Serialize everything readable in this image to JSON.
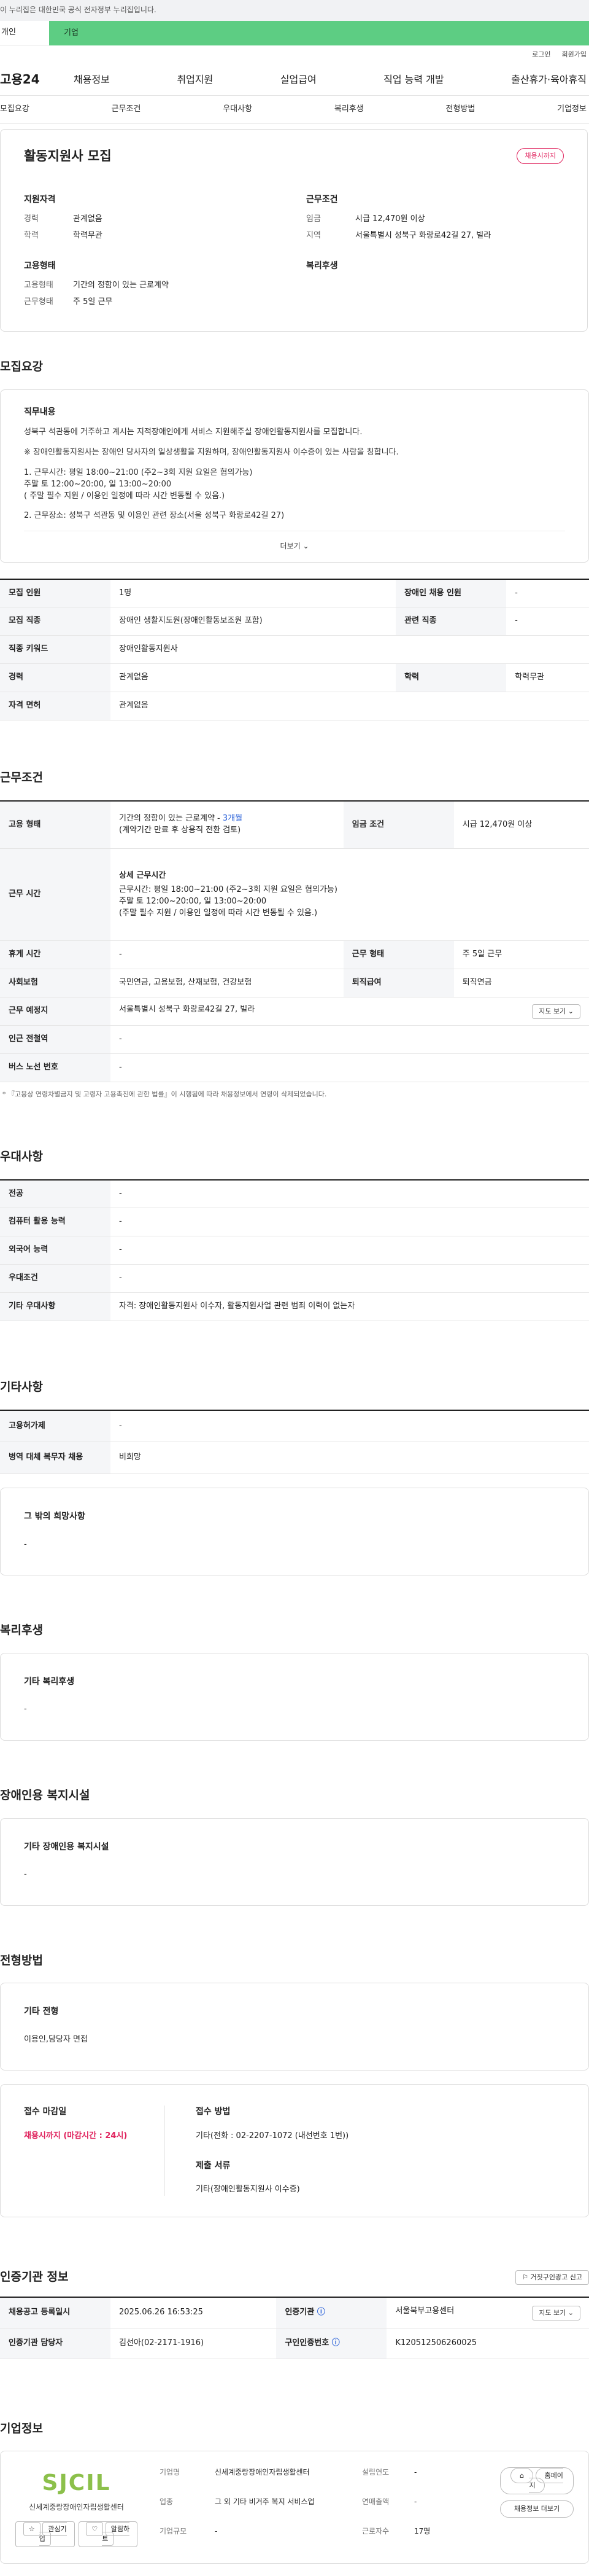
{
  "top_banner": "이 누리집은 대한민국 공식 전자정부 누리집입니다.",
  "tabs": {
    "personal": "개인",
    "business": "기업"
  },
  "util": {
    "login": "로그인",
    "join": "회원가입"
  },
  "gnb": {
    "logo": "고용24",
    "menu": [
      "채용정보",
      "취업지원",
      "실업급여",
      "직업 능력 개발",
      "출산휴가·육아휴직"
    ]
  },
  "subnav": [
    "모집요강",
    "근무조건",
    "우대사항",
    "복리후생",
    "전형방법",
    "기업정보"
  ],
  "header": {
    "title": "활동지원사 모집",
    "badge": "채용시까지",
    "qualification": {
      "heading": "지원자격",
      "rows": [
        {
          "k": "경력",
          "v": "관계없음"
        },
        {
          "k": "학력",
          "v": "학력무관"
        }
      ]
    },
    "work_condition": {
      "heading": "근무조건",
      "rows": [
        {
          "k": "임금",
          "v": "시급 12,470원 이상"
        },
        {
          "k": "지역",
          "v": "서울특별시 성북구 화랑로42길 27, 빌라"
        }
      ]
    },
    "employment": {
      "heading": "고용형태",
      "rows": [
        {
          "k": "고용형태",
          "v": "기간의 정함이 있는 근로계약"
        },
        {
          "k": "근무형태",
          "v": "주 5일 근무"
        }
      ]
    },
    "welfare": {
      "heading": "복리후생"
    }
  },
  "recruit": {
    "title": "모집요강",
    "duty_heading": "직무내용",
    "duty_p1": "성북구 석관동에 거주하고 계시는 지적장애인에게 서비스 지원해주실 장애인활동지원사를 모집합니다.",
    "duty_p2": "※ 장애인활동지원사는 장애인 당사자의 일상생활을 지원하며, 장애인활동지원사 이수증이 있는 사람을 칭합니다.",
    "duty_p3": "1. 근무시간: 평일  18:00~21:00 (주2~3회 지원 요일은 협의가능)\n주말  토 12:00~20:00, 일 13:00~20:00\n( 주말 필수 지원 / 이용인 일정에 따라 시간 변동될 수 있음.)",
    "duty_p4": "2. 근무장소: 성북구 석관동 및 이용인 관련 장소(서울 성북구 화랑로42길 27)",
    "more": "더보기",
    "table": {
      "headcount_label": "모집 인원",
      "headcount": "1명",
      "disabled_label": "장애인 채용 인원",
      "disabled": "-",
      "job_label": "모집 직종",
      "job": "장애인 생활지도원(장애인활동보조원 포함)",
      "related_label": "관련 직종",
      "related": "-",
      "keyword_label": "직종 키워드",
      "keyword": "장애인활동지원사",
      "career_label": "경력",
      "career": "관계없음",
      "edu_label": "학력",
      "edu": "학력무관",
      "license_label": "자격 면허",
      "license": "관계없음"
    }
  },
  "work": {
    "title": "근무조건",
    "emp_type_label": "고용 형태",
    "emp_type_1": "기간의 정함이 있는 근로계약 - ",
    "emp_type_months": "3개월",
    "emp_type_2": "(계약기간 만료 후 상용직 전환 검토)",
    "wage_label": "임금 조건",
    "wage": "시급 12,470원 이상",
    "hours_label": "근무 시간",
    "hours_heading": "상세 근무시간",
    "hours_text": "근무시간: 평일  18:00~21:00 (주2~3회 지원 요일은 협의가능)\n주말  토 12:00~20:00, 일 13:00~20:00\n(주말 필수 지원 / 이용인 일정에 따라 시간 변동될 수 있음.)",
    "break_label": "휴게 시간",
    "break": "-",
    "shift_label": "근무 형태",
    "shift": "주 5일 근무",
    "insurance_label": "사회보험",
    "insurance": "국민연금, 고용보험, 산재보험, 건강보험",
    "retire_label": "퇴직급여",
    "retire": "퇴직연금",
    "place_label": "근무 예정지",
    "place": "서울특별시 성북구 화랑로42길 27, 빌라",
    "map_btn": "지도 보기",
    "station_label": "인근 전철역",
    "station": "-",
    "bus_label": "버스 노선 번호",
    "bus": "-",
    "footnote": "* 『고용상 연령차별금지 및 고령자 고용촉진에 관한 법률』이 시행됨에 따라 채용정보에서 연령이 삭제되었습니다."
  },
  "prefer": {
    "title": "우대사항",
    "rows": [
      {
        "k": "전공",
        "v": "-"
      },
      {
        "k": "컴퓨터 활용 능력",
        "v": "-"
      },
      {
        "k": "외국어 능력",
        "v": "-"
      },
      {
        "k": "우대조건",
        "v": "-"
      },
      {
        "k": "기타 우대사항",
        "v": "자격: 장애인활동지원사 이수자, 활동지원사업 관련 범죄 이력이 없는자"
      }
    ]
  },
  "etc": {
    "title": "기타사항",
    "rows": [
      {
        "k": "고용허가제",
        "v": "-"
      },
      {
        "k": "병역 대체 복무자 채용",
        "v": "비희망"
      }
    ],
    "other_heading": "그 밖의 희망사항",
    "other_value": "-"
  },
  "welfare_sec": {
    "title": "복리후생",
    "heading": "기타 복리후생",
    "value": "-"
  },
  "facility": {
    "title": "장애인용 복지시설",
    "heading": "기타 장애인용 복지시설",
    "value": "-"
  },
  "selection": {
    "title": "전형방법",
    "heading": "기타 전형",
    "value": "이용인,담당자 면접",
    "deadline_heading": "접수 마감일",
    "deadline_value": "채용시까지 (마감시간 : 24시)",
    "method_heading": "접수 방법",
    "method_value": "기타(전화 : 02-2207-1072 (내선번호 1번))",
    "docs_heading": "제출 서류",
    "docs_value": "기타(장애인활동지원사 이수증)"
  },
  "agency": {
    "title": "인증기관 정보",
    "report_btn": "거짓구인광고 신고",
    "reg_label": "채용공고 등록일시",
    "reg": "2025.06.26 16:53:25",
    "agency_label": "인증기관",
    "agency_name": "서울북부고용센터",
    "map_btn": "지도 보기",
    "manager_label": "인증기관 담당자",
    "manager": "김선아(02-2171-1916)",
    "job_no_label": "구인인증번호",
    "job_no": "K120512506260025"
  },
  "company": {
    "title": "기업정보",
    "logo_text": "SJCIL",
    "logo_sub": "신세계중랑장애인자립생활센터",
    "btn_interest": "관심기업",
    "btn_alert": "알림하트",
    "name_label": "기업명",
    "name": "신세계중랑장애인자립생활센터",
    "industry_label": "업종",
    "industry": "그 외 기타 비거주 복지 서비스업",
    "size_label": "기업규모",
    "size": "-",
    "founded_label": "설립연도",
    "founded": "-",
    "sales_label": "연매출액",
    "sales": "-",
    "staff_label": "근로자수",
    "staff": "17명",
    "homepage_btn": "홈페이지",
    "jobs_btn": "채용정보 더보기"
  },
  "colors": {
    "accent": "#5dcd83",
    "badge": "#e0245e",
    "link": "#2b62d9",
    "logo": "#8cc04b"
  }
}
